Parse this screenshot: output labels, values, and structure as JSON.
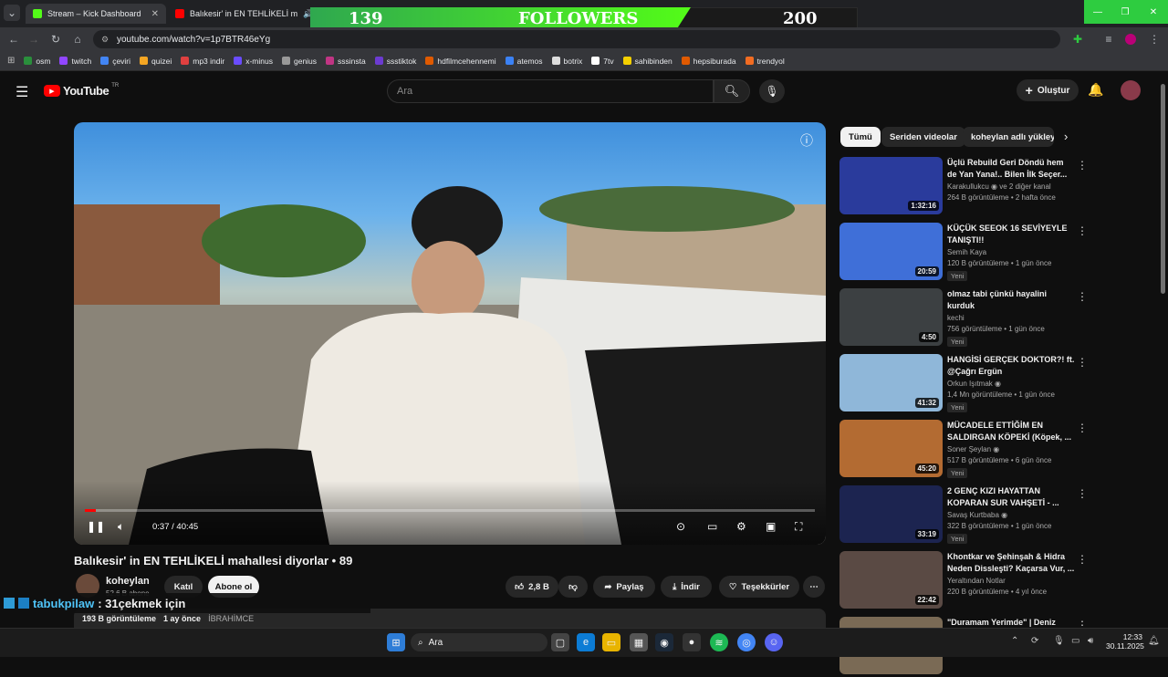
{
  "browser": {
    "tabs": [
      {
        "label": "Stream – Kick Dashboard",
        "close": "✕"
      },
      {
        "label": "Balıkesir' in EN TEHLİKELİ m",
        "close": "✕"
      }
    ],
    "new_tab": "+",
    "url": "youtube.com/watch?v=1p7BTR46eYg",
    "bookmarks": [
      "osm",
      "twitch",
      "çeviri",
      "quizei",
      "mp3 indir",
      "x-minus",
      "genius",
      "sssinsta",
      "ssstiktok",
      "hdfilmcehennemi",
      "atemos",
      "botrix",
      "7tv",
      "sahibinden",
      "hepsiburada",
      "trendyol"
    ]
  },
  "overlay": {
    "current": "139",
    "label": "FOLLOWERS",
    "goal": "200",
    "progress": 0.695
  },
  "youtube": {
    "logo": "YouTube",
    "logo_sup": "TR",
    "search_placeholder": "Ara",
    "create_label": "Oluştur"
  },
  "video": {
    "time": "0:37 / 40:45",
    "progress": 0.015,
    "title": "Balıkesir' in EN TEHLİKELİ mahallesi diyorlar • 89",
    "channel": "koheylan",
    "subs": "52,6 B abone",
    "join": "Katıl",
    "subscribe": "Abone ol",
    "likes": "2,8 B",
    "share": "Paylaş",
    "download": "İndir",
    "thanks": "Teşekkürler",
    "views": "193 B görüntüleme",
    "ago": "1 ay önce",
    "desc": "İBRAHİMCE"
  },
  "chat": {
    "user": "tabukpilaw",
    "message": ": 31çekmek için"
  },
  "chips": [
    "Tümü",
    "Seriden videolar",
    "koheylan adlı yükleyic"
  ],
  "recs": [
    {
      "title": "Üçlü Rebuild Geri Döndü hem de Yan Yana!.. Bilen İlk Seçer... ...",
      "channel": "Karakullukcu ◉ ve 2 diğer kanal",
      "meta": "264 B görüntüleme • 2 hafta önce",
      "dur": "1:32:16",
      "badge": "",
      "color": "#2a3b9c"
    },
    {
      "title": "KÜÇÜK SEEOK 16 SEVİYEYLE TANIŞTI!!",
      "channel": "Semih Kaya",
      "meta": "120 B görüntüleme • 1 gün önce",
      "dur": "20:59",
      "badge": "Yeni",
      "color": "#3f6fd8"
    },
    {
      "title": "olmaz tabi çünkü hayalini kurduk",
      "channel": "kechi",
      "meta": "756 görüntüleme • 1 gün önce",
      "dur": "4:50",
      "badge": "Yeni",
      "color": "#3c4042"
    },
    {
      "title": "HANGİSİ GERÇEK DOKTOR?! ft. @Çağrı Ergün",
      "channel": "Orkun Işıtmak ◉",
      "meta": "1,4 Mn görüntüleme • 1 gün önce",
      "dur": "41:32",
      "badge": "Yeni",
      "color": "#8fb7d9"
    },
    {
      "title": "MÜCADELE ETTİĞİM EN SALDIRGAN KÖPEKİ (Köpek, ...",
      "channel": "Soner Şeylan ◉",
      "meta": "517 B görüntüleme • 6 gün önce",
      "dur": "45:20",
      "badge": "Yeni",
      "color": "#b36b32"
    },
    {
      "title": "2 GENÇ KIZI HAYATTAN KOPARAN SUR VAHŞETİ - ...",
      "channel": "Savaş Kurtbaba ◉",
      "meta": "322 B görüntüleme • 1 gün önce",
      "dur": "33:19",
      "badge": "Yeni",
      "color": "#1c2450"
    },
    {
      "title": "Khontkar ve Şehinşah & Hidra Neden Dissleşti? Kaçarsa Vur, ...",
      "channel": "Yeraltından Notlar",
      "meta": "220 B görüntüleme • 4 yıl önce",
      "dur": "22:42",
      "badge": "",
      "color": "#5a4a44"
    },
    {
      "title": "\"Duramam Yerimde\" | Deniz",
      "channel": "",
      "meta": "",
      "dur": "",
      "badge": "",
      "color": "#7a6a55"
    }
  ],
  "taskbar": {
    "search": "Ara",
    "time": "12:33",
    "date": "30.11.2025"
  }
}
